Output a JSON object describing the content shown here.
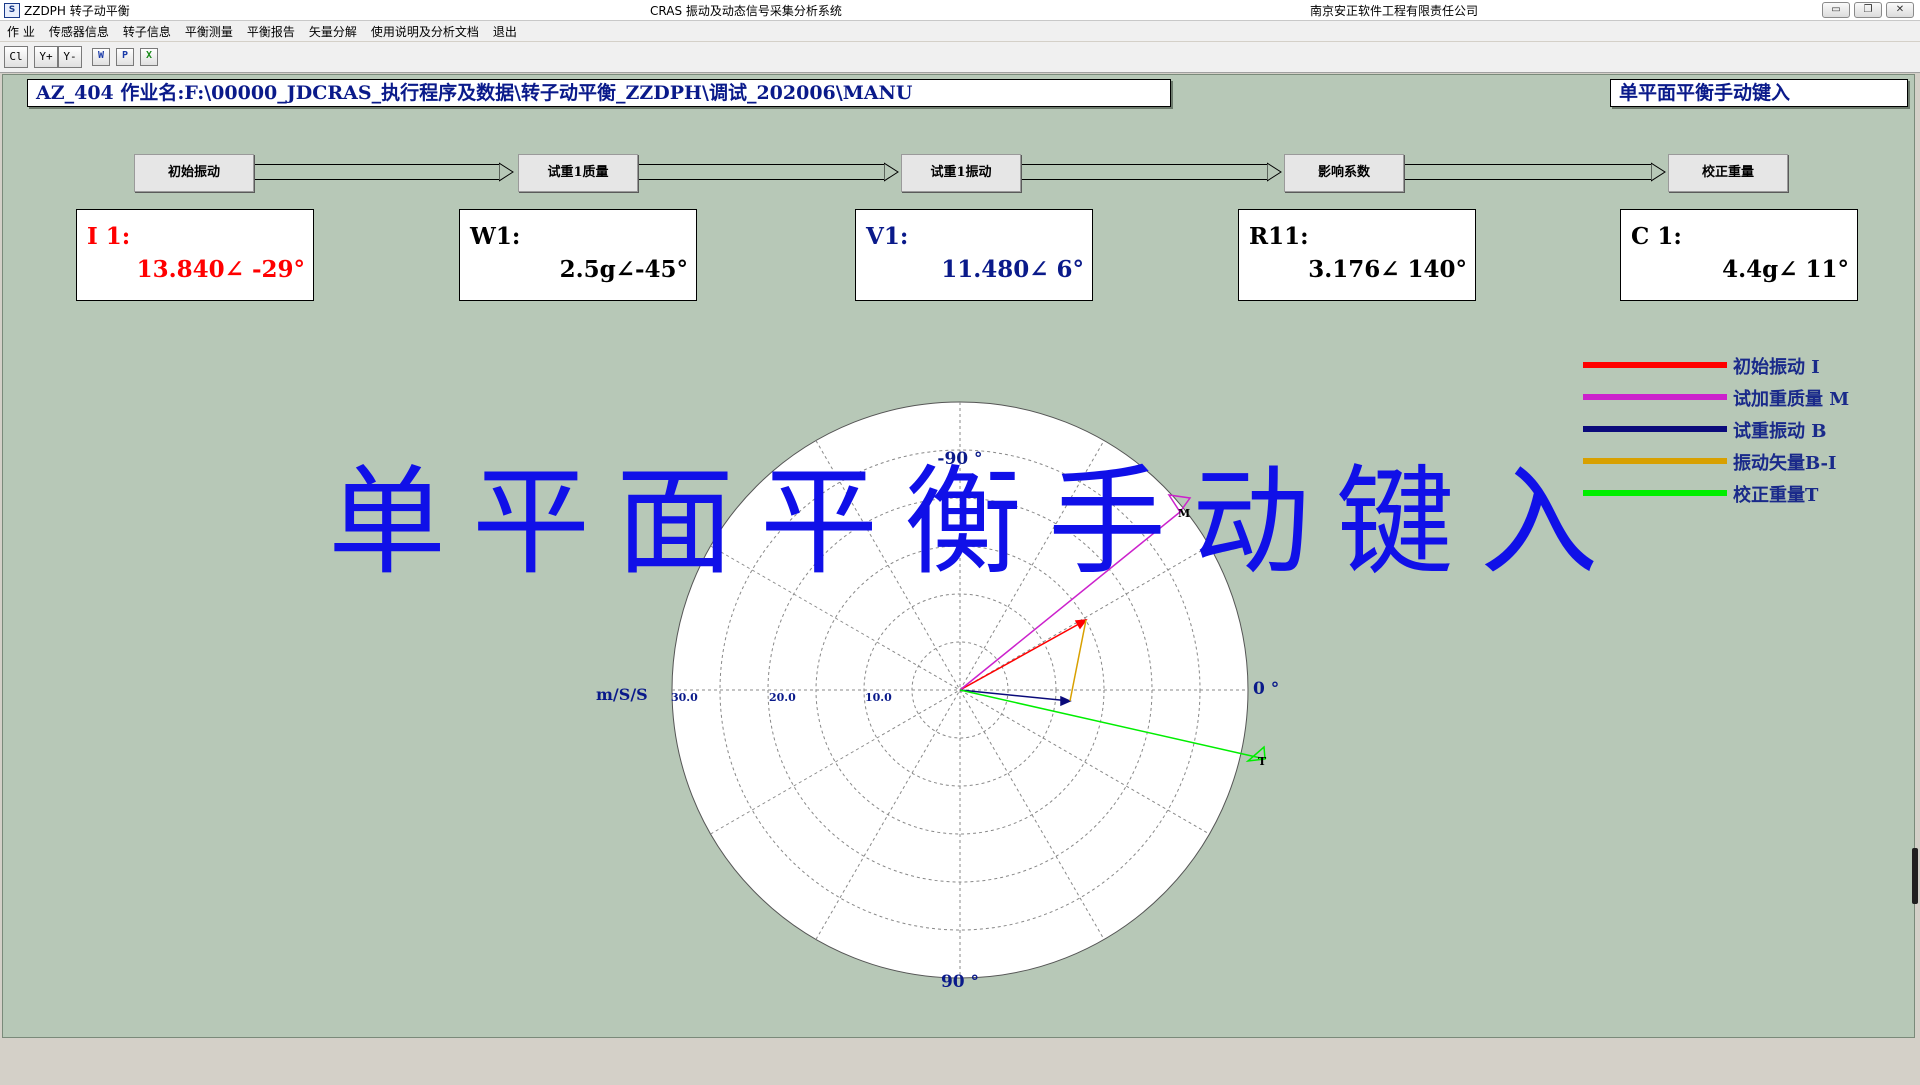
{
  "window": {
    "app_name": "ZZDPH 转子动平衡",
    "center_title": "CRAS 振动及动态信号采集分析系统",
    "company": "南京安正软件工程有限责任公司",
    "buttons": {
      "minimize": "▭",
      "restore": "❐",
      "close": "✕"
    }
  },
  "menu": [
    "作 业",
    "传感器信息",
    "转子信息",
    "平衡测量",
    "平衡报告",
    "矢量分解",
    "使用说明及分析文档",
    "退出"
  ],
  "toolbar": {
    "cl": "Cl",
    "y_plus": "Y+",
    "y_minus": "Y-",
    "w": "W",
    "p": "P",
    "x": "X"
  },
  "header": {
    "path": "AZ_404 作业名:F:\\00000_JDCRAS_执行程序及数据\\转子动平衡_ZZDPH\\调试_202006\\MANU",
    "mode": "单平面平衡手动键入"
  },
  "steps": [
    "初始振动",
    "试重1质量",
    "试重1振动",
    "影响系数",
    "校正重量"
  ],
  "values": [
    {
      "label": "I 1:",
      "value": "13.840∠ -29°",
      "color": "#ff0000"
    },
    {
      "label": "W1:",
      "value": "2.5g∠-45°",
      "color": "#000000"
    },
    {
      "label": "V1:",
      "value": "11.480∠ 6°",
      "color": "#0a1a8a"
    },
    {
      "label": "R11:",
      "value": "3.176∠ 140°",
      "color": "#000000"
    },
    {
      "label": "C 1:",
      "value": "4.4g∠ 11°",
      "color": "#000000"
    }
  ],
  "overlay_title": "单平面平衡手动键入",
  "polar": {
    "unit": "m/S/S",
    "angle_top": "-90 °",
    "angle_bottom": "90 °",
    "angle_right": "0 °",
    "radial_ticks": [
      "30.0",
      "20.0",
      "10.0"
    ],
    "marker_m": "M",
    "marker_t": "T"
  },
  "legend": [
    {
      "label": "初始振动 I",
      "color": "#ff0000"
    },
    {
      "label": "试加重质量 M",
      "color": "#cc22cc"
    },
    {
      "label": "试重振动 B",
      "color": "#0a0a7a"
    },
    {
      "label": "振动矢量B-I",
      "color": "#d8a000"
    },
    {
      "label": "校正重量T",
      "color": "#00ee00"
    }
  ]
}
